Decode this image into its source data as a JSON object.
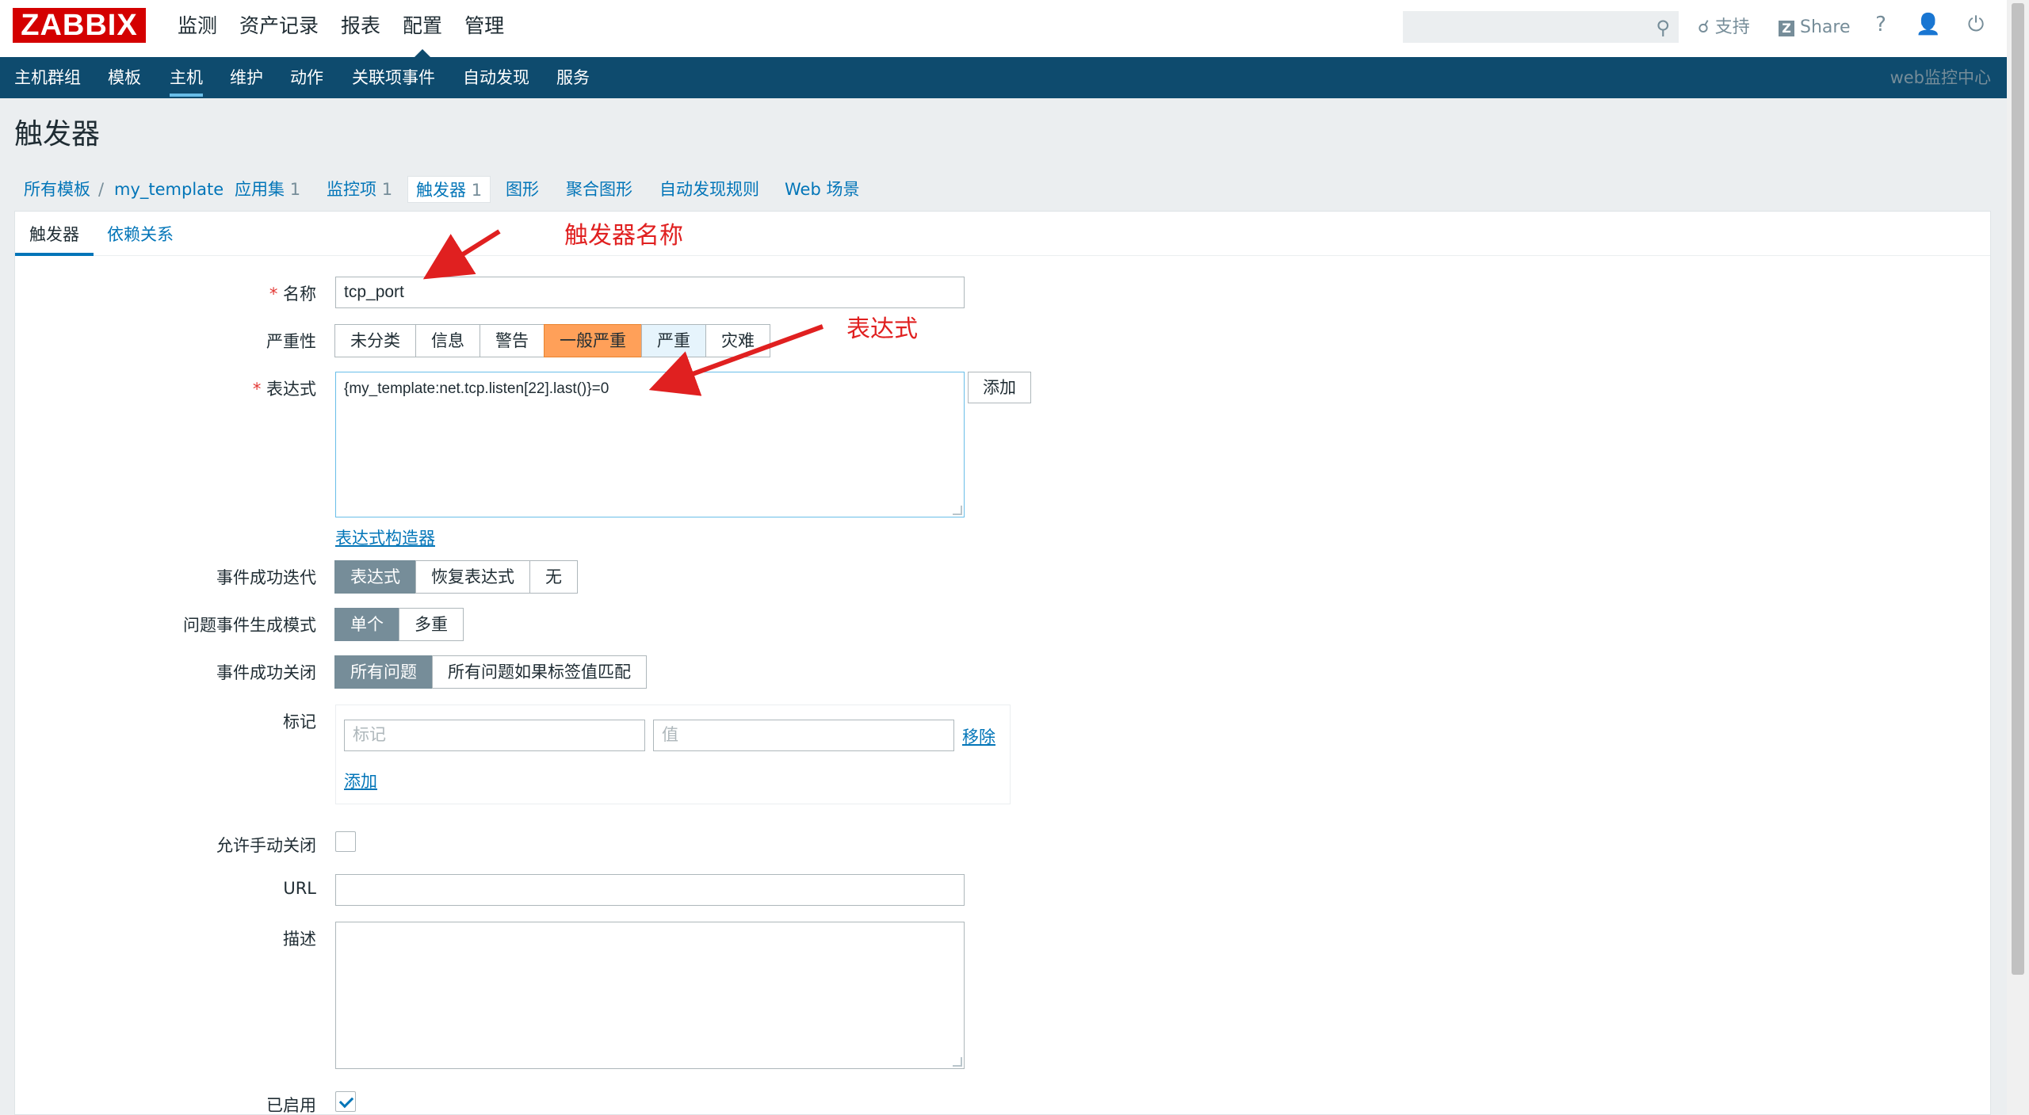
{
  "header": {
    "logo": "ZABBIX",
    "menu": [
      "监测",
      "资产记录",
      "报表",
      "配置",
      "管理"
    ],
    "support": "支持",
    "share": "Share",
    "help": "?"
  },
  "subnav": {
    "items": [
      "主机群组",
      "模板",
      "主机",
      "维护",
      "动作",
      "关联项事件",
      "自动发现",
      "服务"
    ],
    "right": "web监控中心"
  },
  "page": {
    "title": "触发器"
  },
  "breadcrumbs": {
    "all_templates": "所有模板",
    "sep": "/",
    "template": "my_template",
    "apps": "应用集",
    "apps_count": "1",
    "items": "监控项",
    "items_count": "1",
    "triggers": "触发器",
    "triggers_count": "1",
    "graphs": "图形",
    "screens": "聚合图形",
    "discovery": "自动发现规则",
    "web": "Web 场景"
  },
  "tabs": [
    "触发器",
    "依赖关系"
  ],
  "form": {
    "name_label": "名称",
    "name_value": "tcp_port",
    "severity_label": "严重性",
    "severity_options": [
      "未分类",
      "信息",
      "警告",
      "一般严重",
      "严重",
      "灾难"
    ],
    "expression_label": "表达式",
    "expression_value": "{my_template:net.tcp.listen[22].last()}=0",
    "add_button": "添加",
    "expr_constructor": "表达式构造器",
    "ok_event_label": "事件成功迭代",
    "ok_event_options": [
      "表达式",
      "恢复表达式",
      "无"
    ],
    "problem_mode_label": "问题事件生成模式",
    "problem_mode_options": [
      "单个",
      "多重"
    ],
    "ok_close_label": "事件成功关闭",
    "ok_close_options": [
      "所有问题",
      "所有问题如果标签值匹配"
    ],
    "tags_label": "标记",
    "tag_placeholder": "标记",
    "value_placeholder": "值",
    "remove": "移除",
    "tag_add": "添加",
    "manual_close_label": "允许手动关闭",
    "url_label": "URL",
    "desc_label": "描述",
    "enabled_label": "已启用"
  },
  "annotations": {
    "name_note": "触发器名称",
    "expr_note": "表达式"
  },
  "colors": {
    "brand": "#d40000",
    "nav": "#0e4b6e",
    "link": "#0275b8",
    "selected_severity": "#ffa059",
    "annotation": "#e02020"
  }
}
